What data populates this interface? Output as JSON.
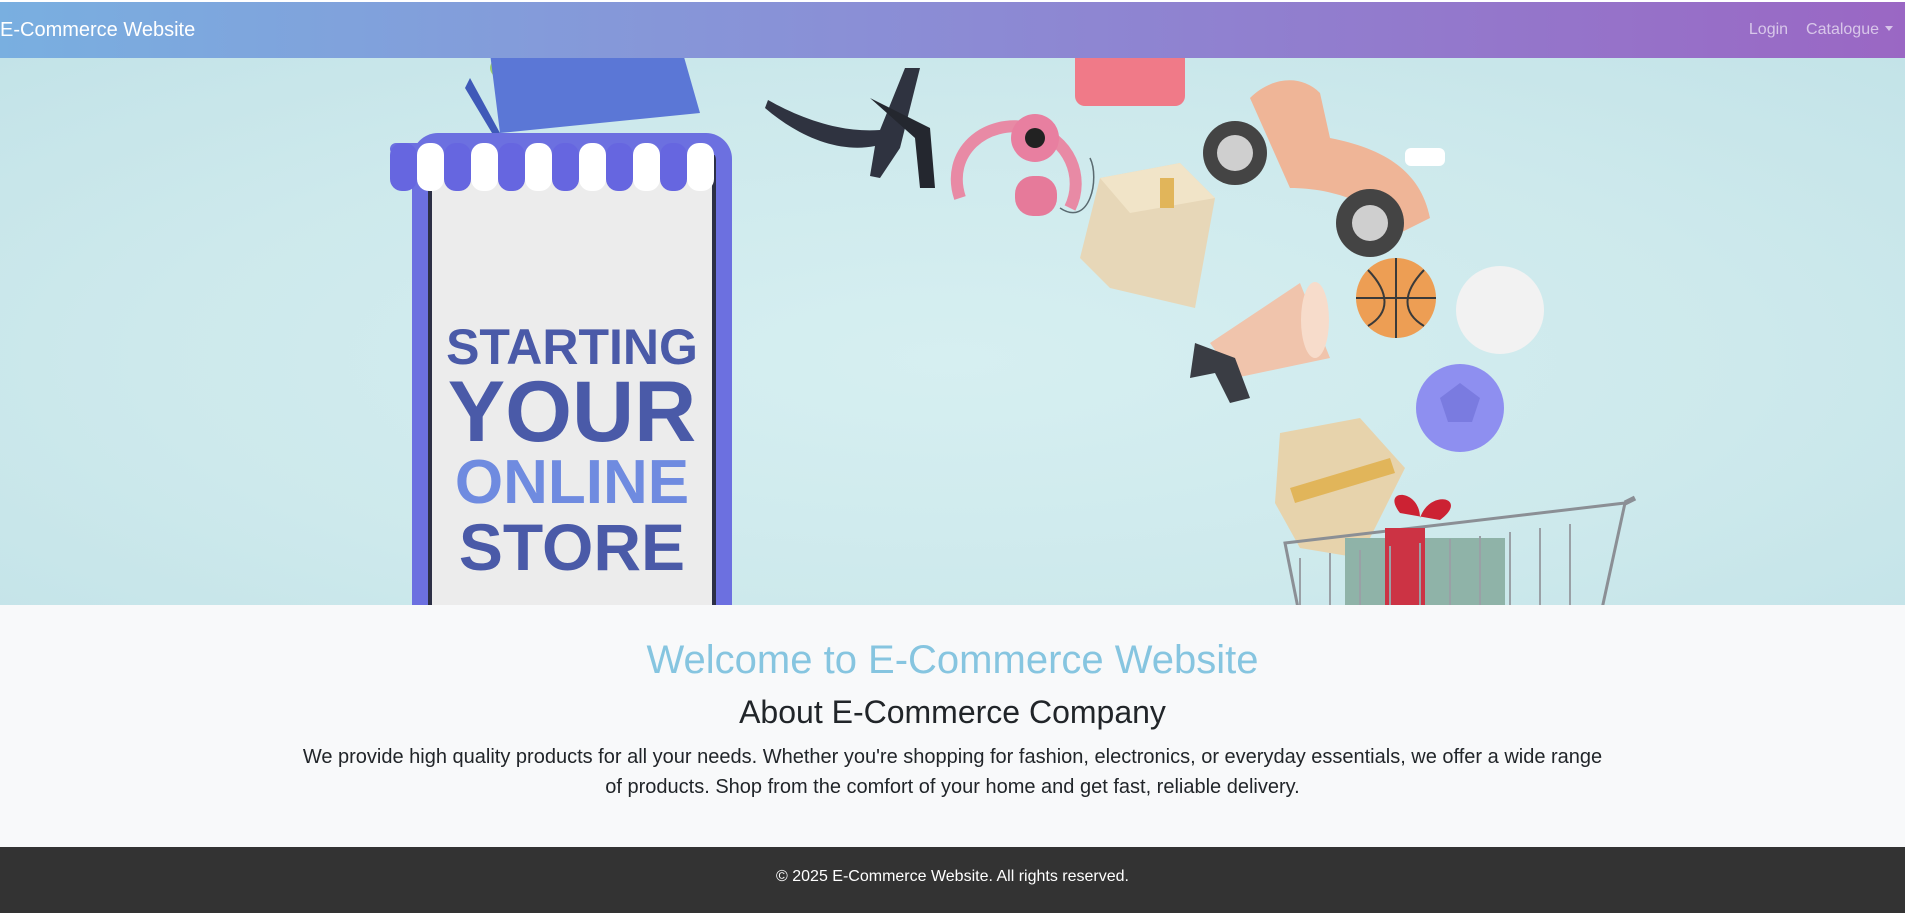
{
  "navbar": {
    "brand": "E-Commerce Website",
    "login_label": "Login",
    "catalogue_label": "Catalogue",
    "gradient_start": "#79afe0",
    "gradient_end": "#9a67c4"
  },
  "hero": {
    "line1": "STARTING",
    "line2": "YOUR",
    "line3": "ONLINE",
    "line4": "STORE",
    "text_color": "#4a5aa8",
    "accent_text_color": "#6f8be0"
  },
  "main": {
    "welcome_title": "Welcome to E-Commerce Website",
    "about_title": "About E-Commerce Company",
    "description": "We provide high quality products for all your needs. Whether you're shopping for fashion, electronics, or everyday essentials, we offer a wide range of products. Shop from the comfort of your home and get fast, reliable delivery.",
    "welcome_color": "#86c5e0"
  },
  "footer": {
    "copyright": "© 2025 E-Commerce Website. All rights reserved."
  }
}
